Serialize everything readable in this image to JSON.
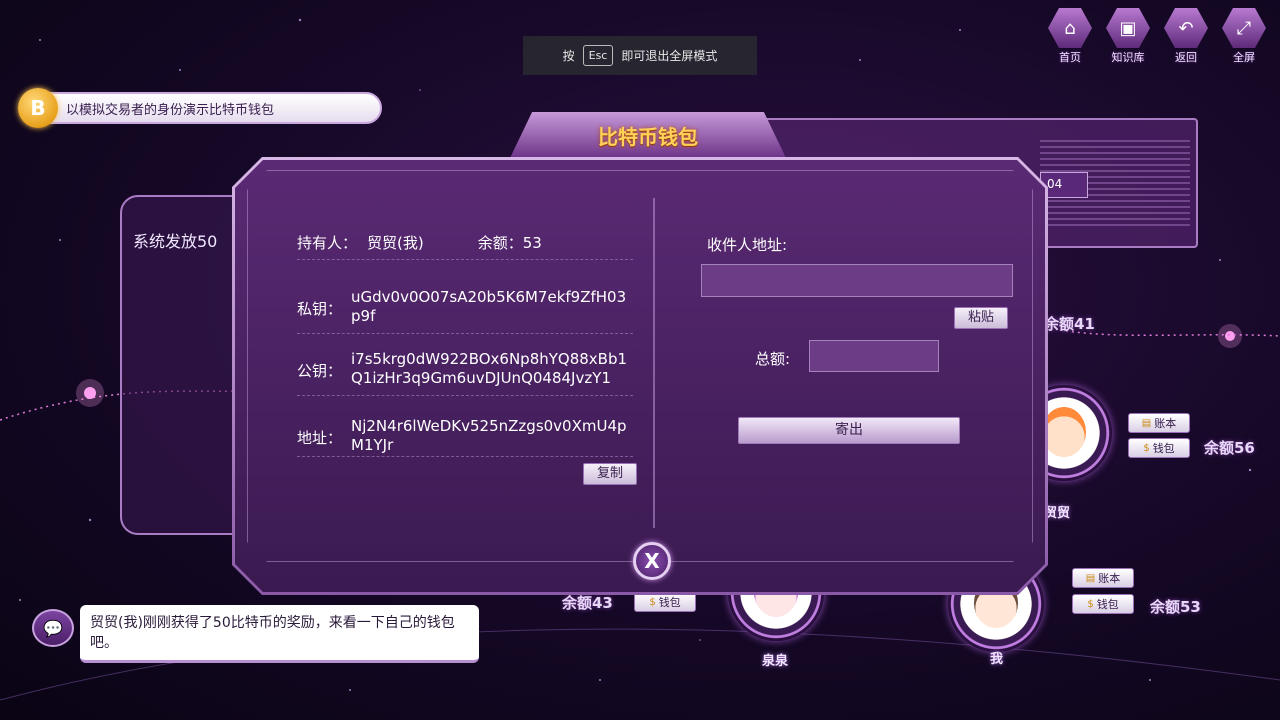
{
  "topnav": {
    "items": [
      {
        "label": "首页",
        "icon": "home-icon"
      },
      {
        "label": "知识库",
        "icon": "book-icon"
      },
      {
        "label": "返回",
        "icon": "back-arrow-icon"
      },
      {
        "label": "全屏",
        "icon": "fullscreen-icon"
      }
    ]
  },
  "esc_hint": {
    "prefix": "按",
    "key": "Esc",
    "suffix": "即可退出全屏模式"
  },
  "task": {
    "coin_symbol": "B",
    "text": "以模拟交易者的身份演示比特币钱包"
  },
  "background": {
    "system_broadcast": "系统发放50",
    "partial_button": "04",
    "characters": [
      {
        "name": "贸贸",
        "balance": "余额56",
        "ledger_label": "账本",
        "wallet_label": "钱包"
      },
      {
        "name": "我",
        "balance": "余额53",
        "ledger_label": "账本",
        "wallet_label": "钱包"
      },
      {
        "name": "泉泉",
        "balance": "余额43",
        "wallet_label": "钱包"
      }
    ],
    "top_balance": "余额41"
  },
  "wallet": {
    "title": "比特币钱包",
    "owner_label": "持有人：",
    "owner_value": "贸贸(我)",
    "balance_text": "余额：53",
    "private_key_label": "私钥：",
    "private_key": "uGdv0v0O07sA20b5K6M7ekf9ZfH03p9f",
    "public_key_label": "公钥：",
    "public_key": "i7s5krg0dW922BOx6Np8hYQ88xBb1Q1izHr3q9Gm6uvDJUnQ0484JvzY1",
    "address_label": "地址：",
    "address": "Nj2N4r6lWeDKv525nZzgs0v0XmU4pM1YJr",
    "copy_label": "复制",
    "recipient_label": "收件人地址:",
    "recipient_value": "",
    "paste_label": "粘贴",
    "amount_label": "总额:",
    "amount_value": "",
    "send_label": "寄出",
    "close_symbol": "X"
  },
  "chat": {
    "icon": "chat-bubble-icon",
    "message": "贸贸(我)刚刚获得了50比特币的奖励，来看一下自己的钱包吧。"
  }
}
